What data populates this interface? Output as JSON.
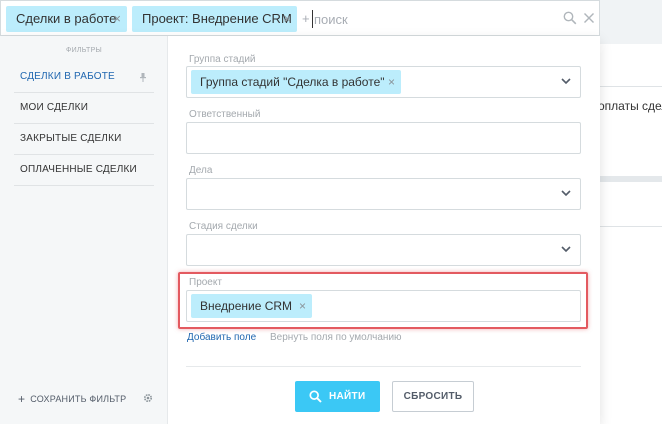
{
  "search": {
    "chips": [
      {
        "label": "Сделки в работе"
      },
      {
        "label": "Проект: Внедрение CRM"
      }
    ],
    "plus": "+",
    "placeholder": "поиск",
    "remove_glyph": "×"
  },
  "background": {
    "partial_text": "оплаты сдел"
  },
  "sidebar": {
    "title": "ФИЛЬТРЫ",
    "items": [
      {
        "label": "СДЕЛКИ В РАБОТЕ",
        "active": true
      },
      {
        "label": "МОИ СДЕЛКИ"
      },
      {
        "label": "ЗАКРЫТЫЕ СДЕЛКИ"
      },
      {
        "label": "ОПЛАЧЕННЫЕ СДЕЛКИ"
      }
    ],
    "save_plus": "+",
    "save_label": "СОХРАНИТЬ ФИЛЬТР"
  },
  "fields": [
    {
      "label": "Группа стадий",
      "chip": "Группа стадий \"Сделка в работе\"",
      "dropdown": true
    },
    {
      "label": "Ответственный",
      "chip": "",
      "dropdown": false
    },
    {
      "label": "Дела",
      "chip": "",
      "dropdown": true
    },
    {
      "label": "Стадия сделки",
      "chip": "",
      "dropdown": true
    },
    {
      "label": "Проект",
      "chip": "Внедрение CRM",
      "dropdown": false
    }
  ],
  "links": {
    "add_field": "Добавить поле",
    "restore_fields": "Вернуть поля по умолчанию"
  },
  "buttons": {
    "find": "НАЙТИ",
    "reset": "СБРОСИТЬ"
  },
  "colors": {
    "accent": "#3bc8f5",
    "chip": "#bcedfc",
    "link": "#2067b0",
    "highlight": "#e35a60"
  }
}
